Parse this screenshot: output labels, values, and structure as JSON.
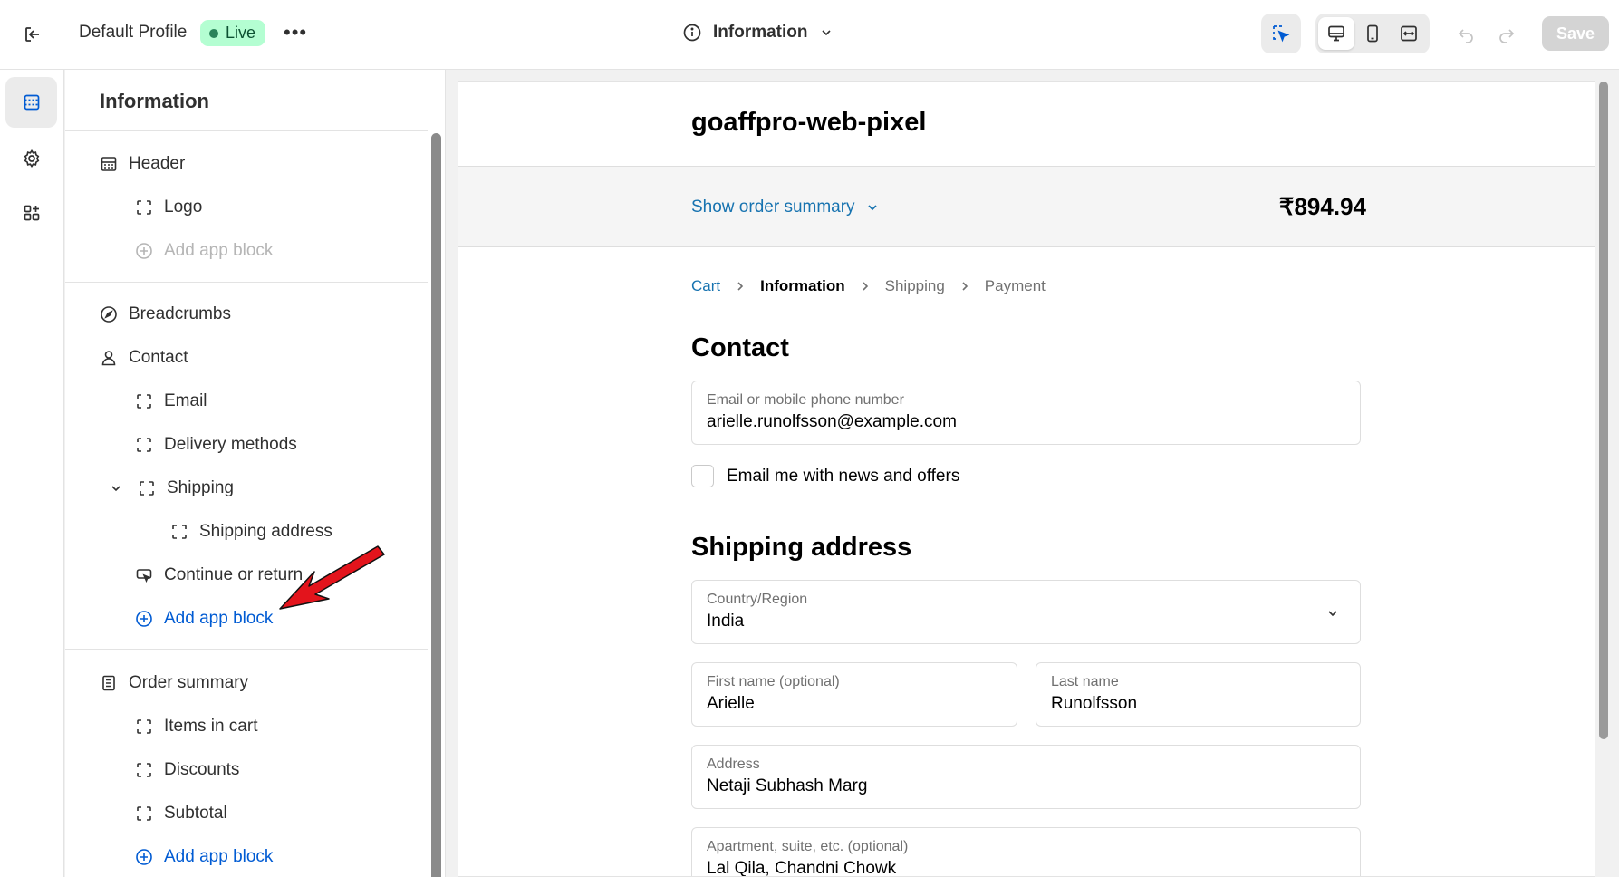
{
  "topbar": {
    "profile_name": "Default Profile",
    "status_badge": "Live",
    "more_label": "•••",
    "page_selector": "Information",
    "save_label": "Save"
  },
  "panel": {
    "title": "Information",
    "items": {
      "header": "Header",
      "logo": "Logo",
      "add_app_block_header": "Add app block",
      "breadcrumbs": "Breadcrumbs",
      "contact": "Contact",
      "email": "Email",
      "delivery_methods": "Delivery methods",
      "shipping": "Shipping",
      "shipping_address": "Shipping address",
      "continue_or_return": "Continue or return",
      "add_app_block_main": "Add app block",
      "order_summary": "Order summary",
      "items_in_cart": "Items in cart",
      "discounts": "Discounts",
      "subtotal": "Subtotal",
      "add_app_block_summary": "Add app block"
    }
  },
  "preview": {
    "store_name": "goaffpro-web-pixel",
    "summary_link": "Show order summary",
    "summary_total": "₹894.94",
    "breadcrumbs": {
      "cart": "Cart",
      "information": "Information",
      "shipping": "Shipping",
      "payment": "Payment"
    },
    "contact_title": "Contact",
    "email_field": {
      "label": "Email or mobile phone number",
      "value": "arielle.runolfsson@example.com"
    },
    "newsletter_label": "Email me with news and offers",
    "shipping_title": "Shipping address",
    "country_field": {
      "label": "Country/Region",
      "value": "India"
    },
    "first_name_field": {
      "label": "First name (optional)",
      "value": "Arielle"
    },
    "last_name_field": {
      "label": "Last name",
      "value": "Runolfsson"
    },
    "address_field": {
      "label": "Address",
      "value": "Netaji Subhash Marg"
    },
    "apartment_field": {
      "label": "Apartment, suite, etc. (optional)",
      "value": "Lal Qila, Chandni Chowk"
    }
  },
  "colors": {
    "link": "#1773b0",
    "editor_link": "#005bd3",
    "live_badge_bg": "#b4fed2",
    "annotation_arrow": "#e3141c"
  }
}
